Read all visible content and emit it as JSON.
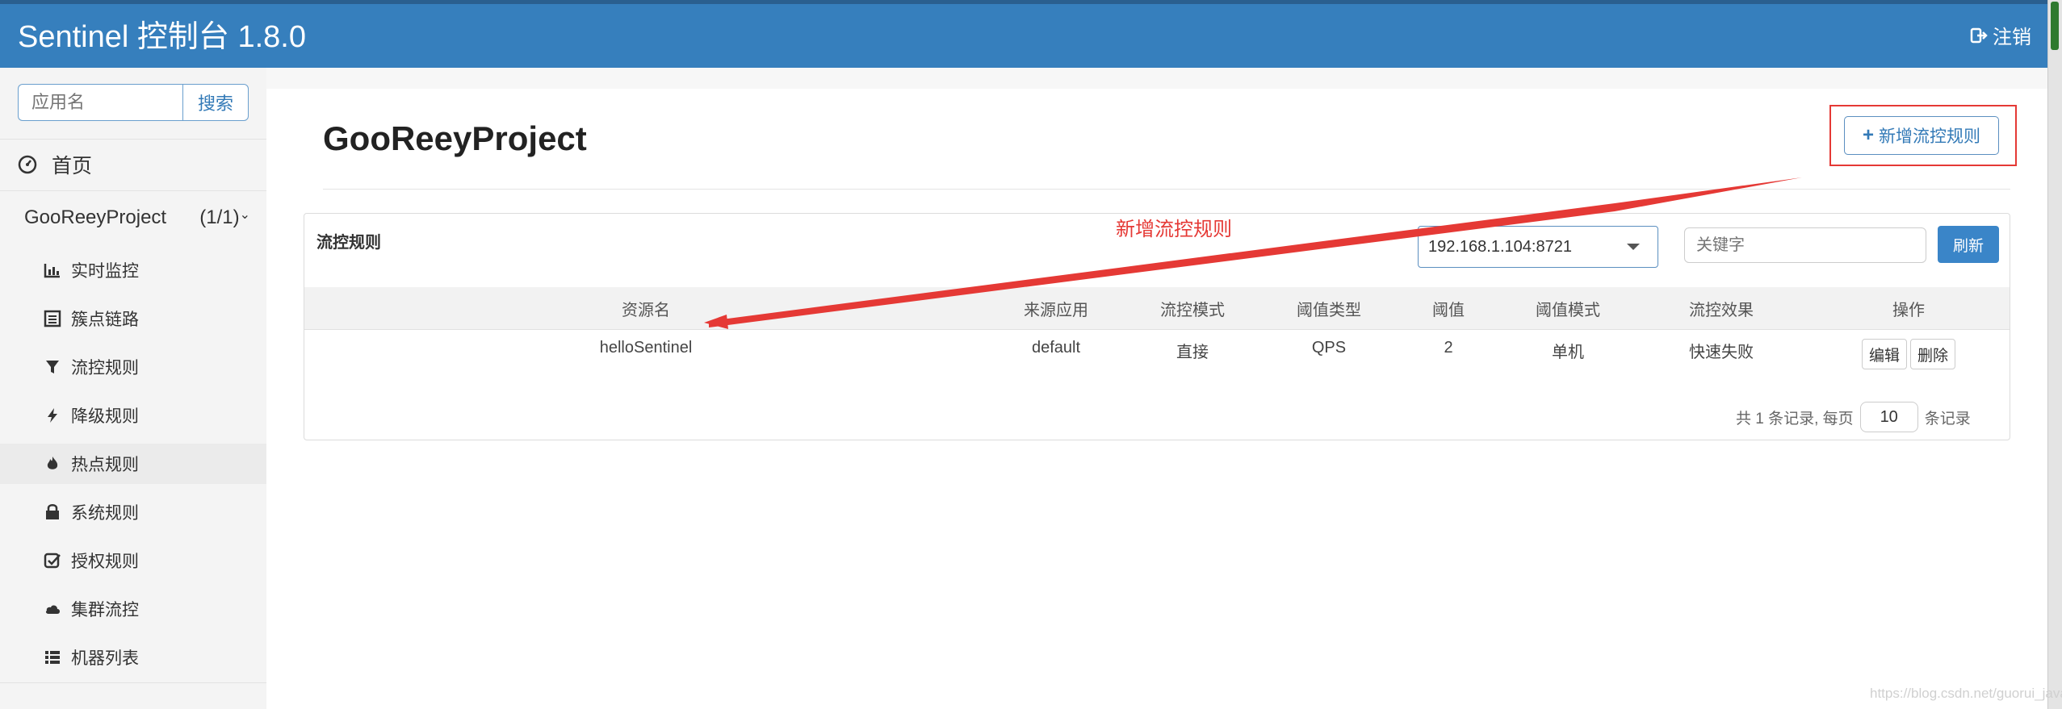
{
  "header": {
    "title": "Sentinel 控制台 1.8.0",
    "logout_label": "注销"
  },
  "sidebar": {
    "search_placeholder": "应用名",
    "search_button": "搜索",
    "home_label": "首页",
    "app_name": "GooReeyProject",
    "app_count": "(1/1)",
    "items": [
      {
        "label": "实时监控",
        "icon": "bar-chart-icon"
      },
      {
        "label": "簇点链路",
        "icon": "list-alt-icon"
      },
      {
        "label": "流控规则",
        "icon": "filter-icon"
      },
      {
        "label": "降级规则",
        "icon": "flash-icon"
      },
      {
        "label": "热点规则",
        "icon": "fire-icon"
      },
      {
        "label": "系统规则",
        "icon": "lock-icon"
      },
      {
        "label": "授权规则",
        "icon": "check-icon"
      },
      {
        "label": "集群流控",
        "icon": "cloud-icon"
      },
      {
        "label": "机器列表",
        "icon": "th-list-icon"
      }
    ]
  },
  "main": {
    "page_title": "GooReeyProject",
    "add_button": "新增流控规则",
    "panel_title": "流控规则",
    "machine_select": "192.168.1.104:8721",
    "keyword_placeholder": "关键字",
    "refresh_button": "刷新",
    "columns": [
      "资源名",
      "来源应用",
      "流控模式",
      "阈值类型",
      "阈值",
      "阈值模式",
      "流控效果",
      "操作"
    ],
    "rows": [
      {
        "resource": "helloSentinel",
        "origin": "default",
        "mode": "直接",
        "grade": "QPS",
        "count": "2",
        "cluster_mode": "单机",
        "effect": "快速失败"
      }
    ],
    "edit_button": "编辑",
    "delete_button": "删除",
    "pager_prefix": "共 1 条记录, 每页",
    "page_size": "10",
    "pager_suffix": "条记录"
  },
  "annotation": {
    "text": "新增流控规则",
    "color": "#e53935"
  },
  "watermark": "https://blog.csdn.net/guorui_java"
}
